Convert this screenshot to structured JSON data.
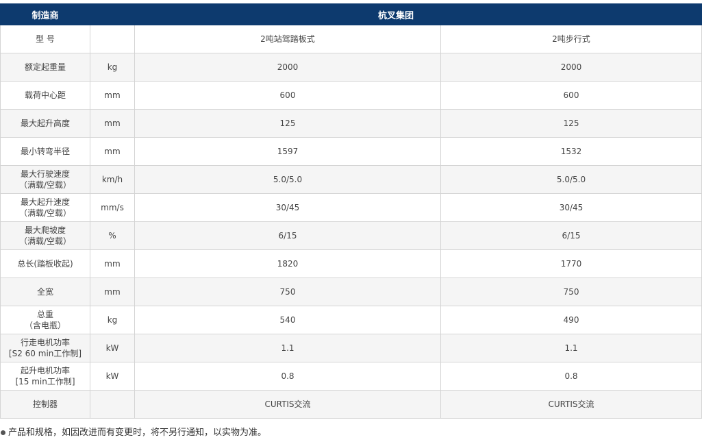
{
  "header": {
    "manufacturer_label": "制造商",
    "manufacturer_value": "杭叉集团"
  },
  "rows": [
    {
      "label": "型  号",
      "label_sub": "",
      "unit": "",
      "v1": "2吨站驾踏板式",
      "v2": "2吨步行式"
    },
    {
      "label": "额定起重量",
      "label_sub": "",
      "unit": "kg",
      "v1": "2000",
      "v2": "2000"
    },
    {
      "label": "载荷中心距",
      "label_sub": "",
      "unit": "mm",
      "v1": "600",
      "v2": "600"
    },
    {
      "label": "最大起升高度",
      "label_sub": "",
      "unit": "mm",
      "v1": "125",
      "v2": "125"
    },
    {
      "label": "最小转弯半径",
      "label_sub": "",
      "unit": "mm",
      "v1": "1597",
      "v2": "1532"
    },
    {
      "label": "最大行驶速度",
      "label_sub": "（满载/空载）",
      "unit": "km/h",
      "v1": "5.0/5.0",
      "v2": "5.0/5.0"
    },
    {
      "label": "最大起升速度",
      "label_sub": "（满载/空载）",
      "unit": "mm/s",
      "v1": "30/45",
      "v2": "30/45"
    },
    {
      "label": "最大爬坡度",
      "label_sub": "（满载/空载）",
      "unit": "%",
      "v1": "6/15",
      "v2": "6/15"
    },
    {
      "label": "总长(踏板收起)",
      "label_sub": "",
      "unit": "mm",
      "v1": "1820",
      "v2": "1770"
    },
    {
      "label": "全宽",
      "label_sub": "",
      "unit": "mm",
      "v1": "750",
      "v2": "750"
    },
    {
      "label": "总重",
      "label_sub": "（含电瓶）",
      "unit": "kg",
      "v1": "540",
      "v2": "490"
    },
    {
      "label": "行走电机功率",
      "label_sub": "[S2 60 min工作制]",
      "unit": "kW",
      "v1": "1.1",
      "v2": "1.1"
    },
    {
      "label": "起升电机功率",
      "label_sub": "[15 min工作制]",
      "unit": "kW",
      "v1": "0.8",
      "v2": "0.8"
    },
    {
      "label": "控制器",
      "label_sub": "",
      "unit": "",
      "v1": "CURTIS交流",
      "v2": "CURTIS交流"
    }
  ],
  "footnote": {
    "text": "产品和规格，如因改进而有变更时，将不另行通知，以实物为准。"
  },
  "colors": {
    "header_bg": "#0d3a6e",
    "header_text": "#ffffff",
    "border": "#d4d4d4",
    "alt_row": "#f5f5f5"
  }
}
